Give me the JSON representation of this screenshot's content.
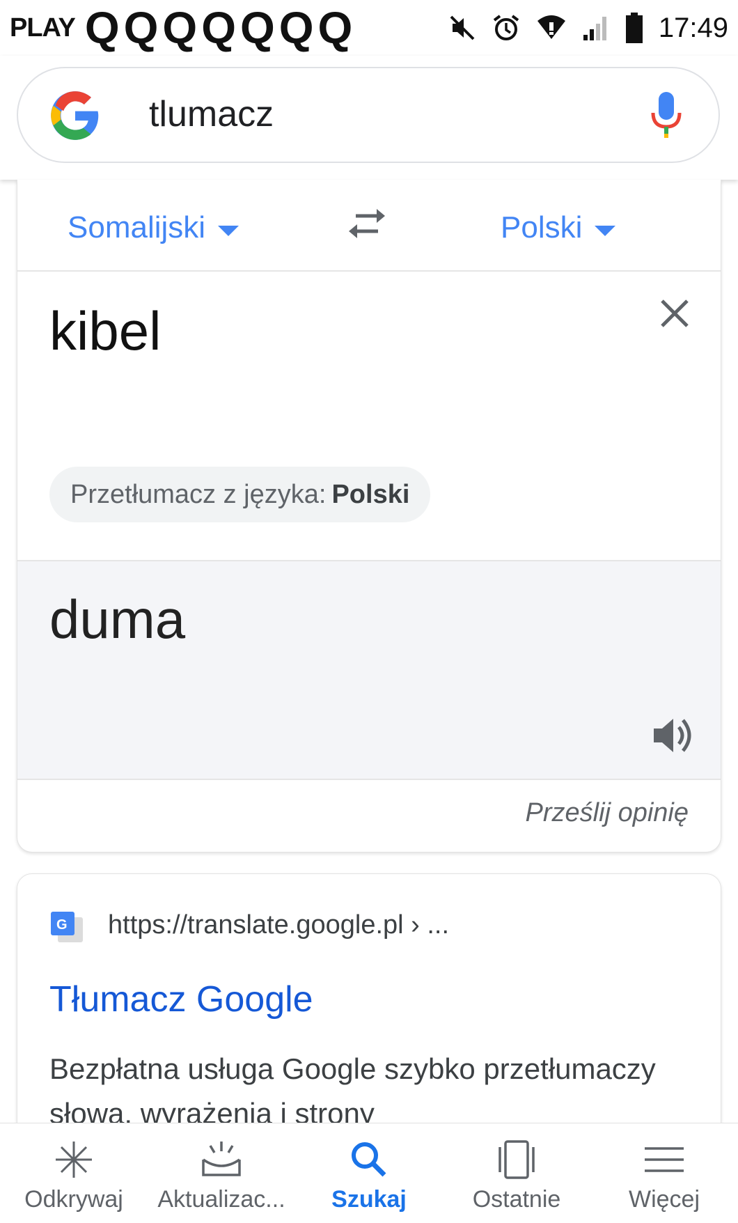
{
  "status_bar": {
    "carrier": "PLAY",
    "notification_icons": [
      "Q",
      "Q",
      "Q",
      "Q",
      "Q",
      "Q",
      "Q"
    ],
    "icons": [
      "mute-icon",
      "alarm-icon",
      "wifi-icon",
      "signal-icon",
      "battery-icon"
    ],
    "time": "17:49"
  },
  "search": {
    "query": "tlumacz"
  },
  "translator": {
    "source_language": "Somalijski",
    "target_language": "Polski",
    "source_text": "kibel",
    "suggestion_prefix": "Przetłumacz z języka:",
    "suggestion_language": "Polski",
    "translation": "duma",
    "feedback_link": "Prześlij opinię"
  },
  "result": {
    "url": "https://translate.google.pl › ...",
    "title": "Tłumacz Google",
    "snippet": "Bezpłatna usługa Google szybko przetłumaczy słowa, wyrażenia i strony"
  },
  "bottom_nav": {
    "items": [
      {
        "label": "Odkrywaj",
        "icon": "discover-icon"
      },
      {
        "label": "Aktualizac...",
        "icon": "updates-icon"
      },
      {
        "label": "Szukaj",
        "icon": "search-icon",
        "active": true
      },
      {
        "label": "Ostatnie",
        "icon": "recent-icon"
      },
      {
        "label": "Więcej",
        "icon": "menu-icon"
      }
    ]
  },
  "colors": {
    "accent": "#4285f4",
    "active_nav": "#1a73e8",
    "link": "#1558d6",
    "output_background": "#f4f5f8"
  }
}
